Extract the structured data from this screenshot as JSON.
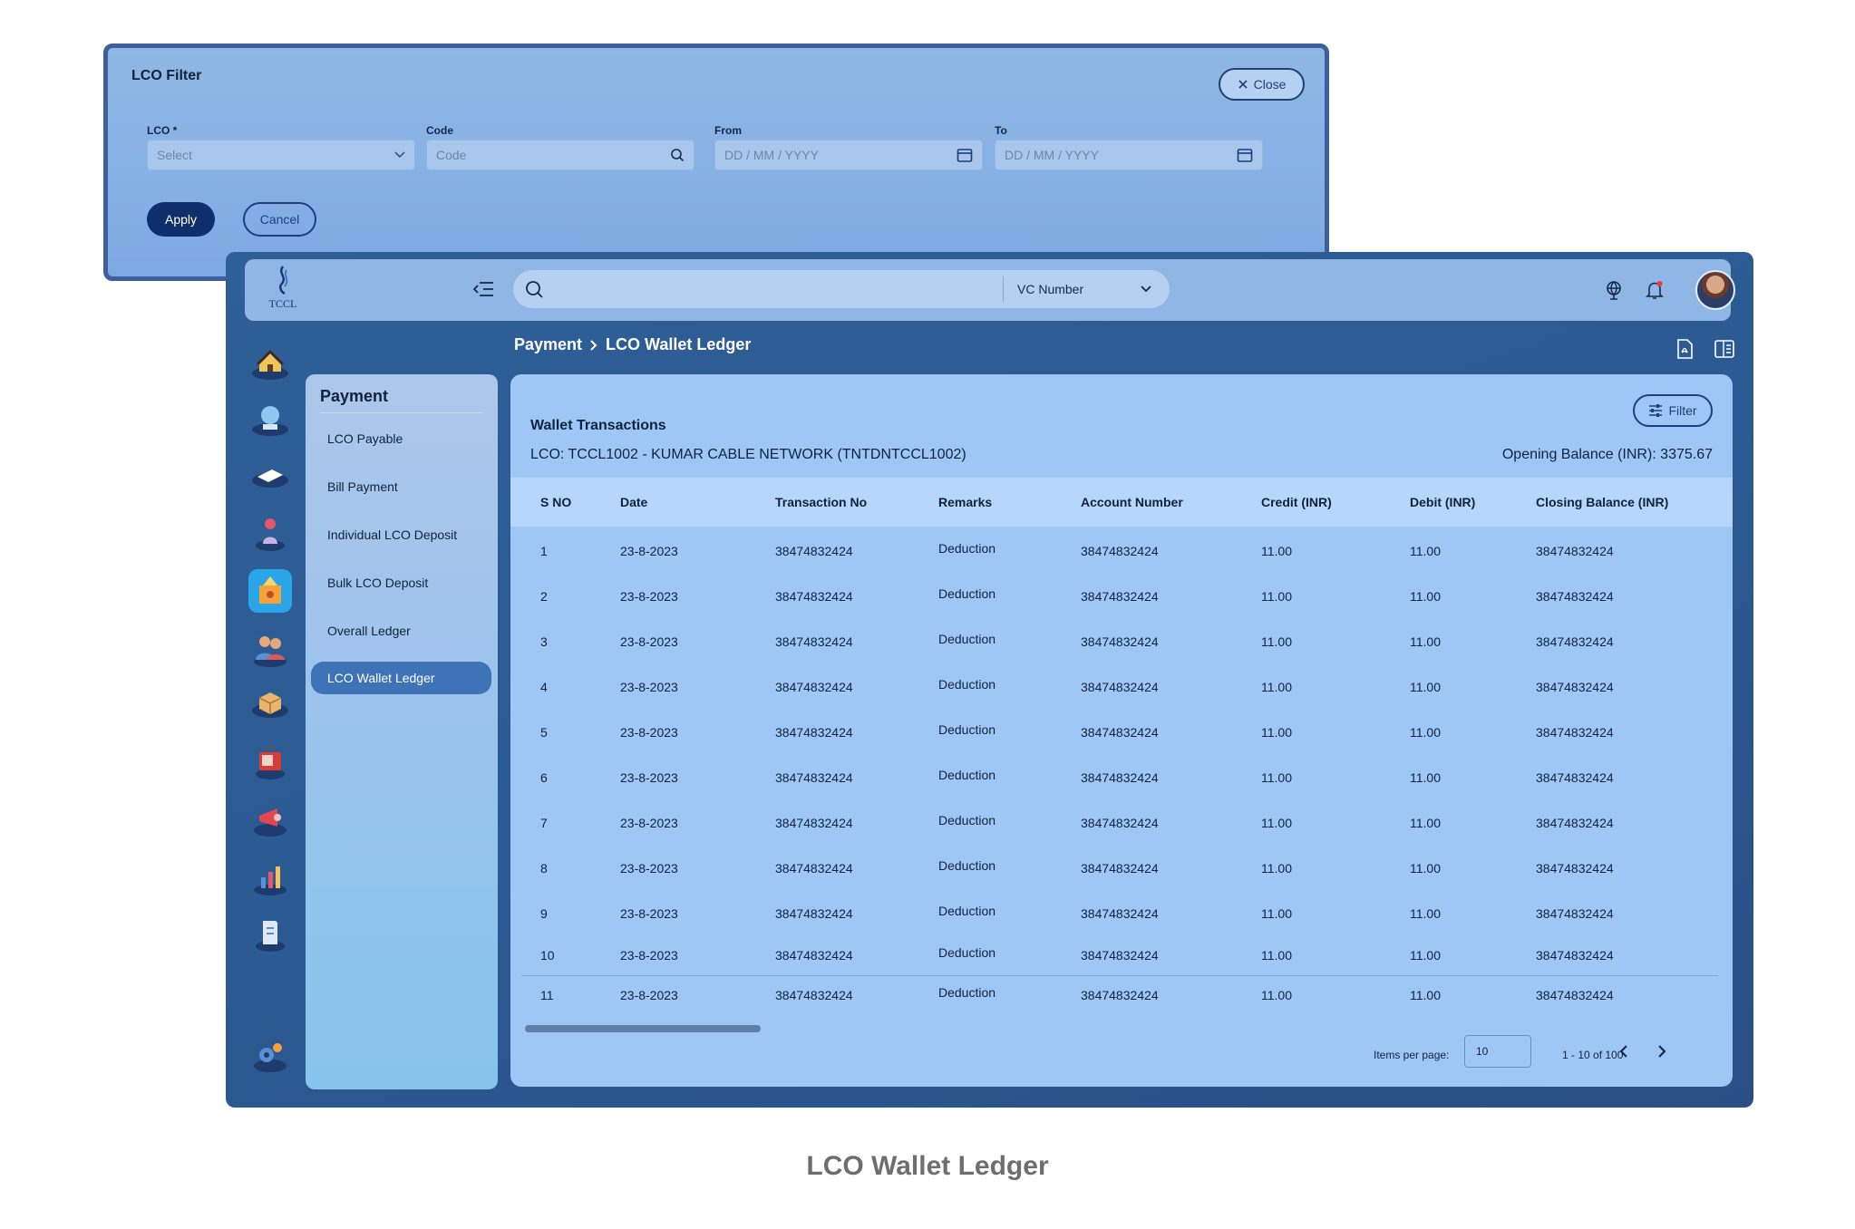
{
  "filter": {
    "title": "LCO Filter",
    "close_label": "Close",
    "lco_label": "LCO *",
    "lco_placeholder": "Select",
    "code_label": "Code",
    "code_placeholder": "Code",
    "from_label": "From",
    "from_placeholder": "DD  /  MM  /  YYYY",
    "to_label": "To",
    "to_placeholder": "DD  /  MM  /  YYYY",
    "apply_label": "Apply",
    "cancel_label": "Cancel"
  },
  "topbar": {
    "logo_text": "TCCL",
    "search_select": "VC Number"
  },
  "breadcrumb": {
    "parent": "Payment",
    "current": "LCO Wallet Ledger"
  },
  "submenu": {
    "title": "Payment",
    "items": [
      "LCO Payable",
      "Bill Payment",
      "Individual LCO Deposit",
      "Bulk LCO Deposit",
      "Overall Ledger",
      "LCO Wallet Ledger"
    ]
  },
  "card": {
    "title": "Wallet Transactions",
    "lco_info": "LCO: TCCL1002 - KUMAR CABLE NETWORK (TNTDNTCCL1002)",
    "opening_balance": "Opening Balance (INR): 3375.67",
    "filter_label": "Filter"
  },
  "table": {
    "columns": [
      "S NO",
      "Date",
      "Transaction No",
      "Remarks",
      "Account Number",
      "Credit (INR)",
      "Debit (INR)",
      "Closing Balance (INR)"
    ],
    "rows": [
      [
        "1",
        "23-8-2023",
        "38474832424",
        "Deduction",
        "38474832424",
        "11.00",
        "11.00",
        "38474832424"
      ],
      [
        "2",
        "23-8-2023",
        "38474832424",
        "Deduction",
        "38474832424",
        "11.00",
        "11.00",
        "38474832424"
      ],
      [
        "3",
        "23-8-2023",
        "38474832424",
        "Deduction",
        "38474832424",
        "11.00",
        "11.00",
        "38474832424"
      ],
      [
        "4",
        "23-8-2023",
        "38474832424",
        "Deduction",
        "38474832424",
        "11.00",
        "11.00",
        "38474832424"
      ],
      [
        "5",
        "23-8-2023",
        "38474832424",
        "Deduction",
        "38474832424",
        "11.00",
        "11.00",
        "38474832424"
      ],
      [
        "6",
        "23-8-2023",
        "38474832424",
        "Deduction",
        "38474832424",
        "11.00",
        "11.00",
        "38474832424"
      ],
      [
        "7",
        "23-8-2023",
        "38474832424",
        "Deduction",
        "38474832424",
        "11.00",
        "11.00",
        "38474832424"
      ],
      [
        "8",
        "23-8-2023",
        "38474832424",
        "Deduction",
        "38474832424",
        "11.00",
        "11.00",
        "38474832424"
      ],
      [
        "9",
        "23-8-2023",
        "38474832424",
        "Deduction",
        "38474832424",
        "11.00",
        "11.00",
        "38474832424"
      ],
      [
        "10",
        "23-8-2023",
        "38474832424",
        "Deduction",
        "38474832424",
        "11.00",
        "11.00",
        "38474832424"
      ],
      [
        "11",
        "23-8-2023",
        "38474832424",
        "Deduction",
        "38474832424",
        "11.00",
        "11.00",
        "38474832424"
      ]
    ]
  },
  "pagination": {
    "items_per_page_label": "Items per page:",
    "items_per_page_value": "10",
    "range": "1 - 10 of 100"
  },
  "caption": "LCO Wallet Ledger"
}
